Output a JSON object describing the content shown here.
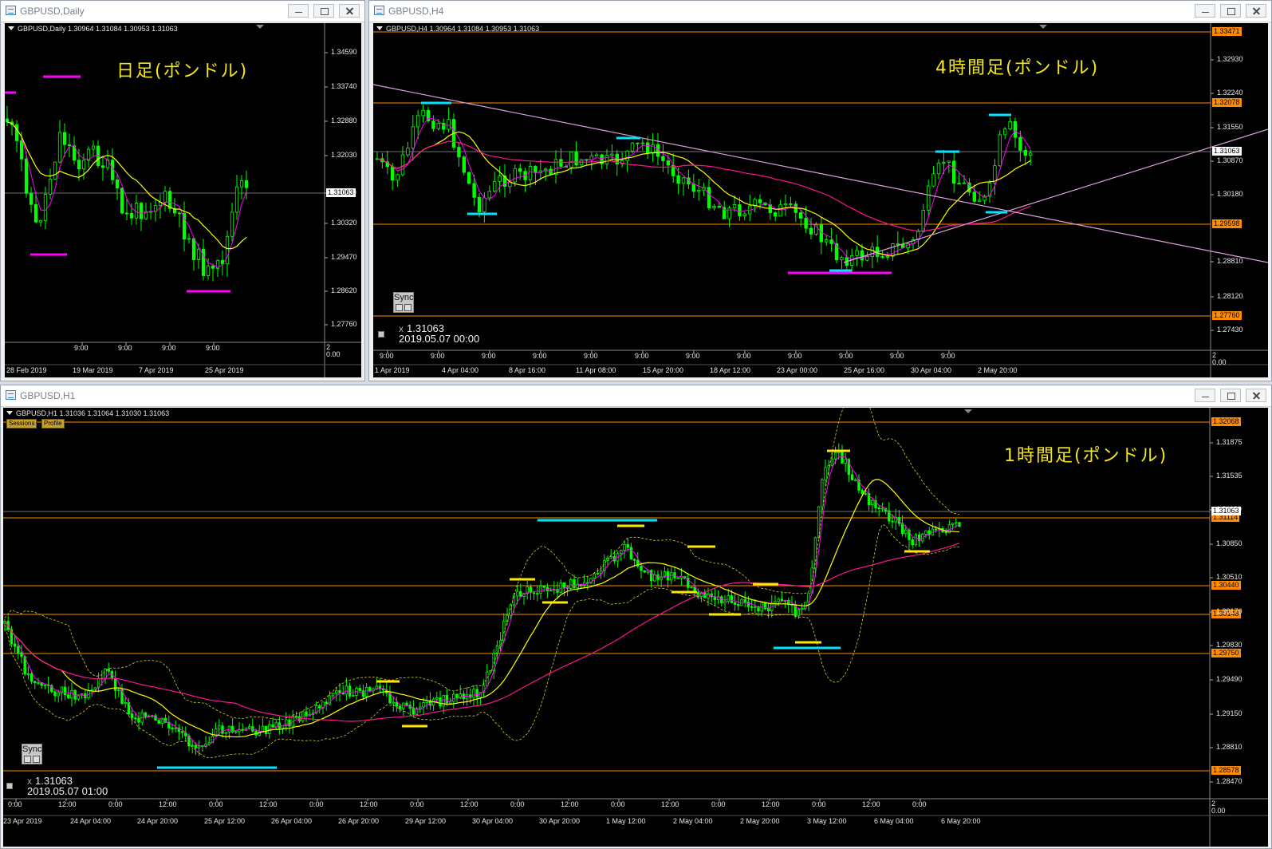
{
  "windows": {
    "daily": {
      "title": "GBPUSD,Daily",
      "header": "GBPUSD,Daily  1.30964 1.31084 1.30953 1.31063",
      "label": "日足(ポンドル)",
      "current_price": "1.31063",
      "price_labels": [
        "1.34590",
        "1.33740",
        "1.32880",
        "1.32030",
        "1.31180",
        "1.30320",
        "1.29470",
        "1.28620",
        "1.27760"
      ],
      "lower_axis_labels": [
        "2",
        "0.00"
      ],
      "time_labels": [
        "9:00",
        "9:00",
        "9:00",
        "9:00"
      ],
      "date_labels": [
        "28 Feb 2019",
        "19 Mar 2019",
        "7 Apr 2019",
        "25 Apr 2019"
      ]
    },
    "h4": {
      "title": "GBPUSD,H4",
      "header": "GBPUSD,H4  1.30964 1.31084 1.30953 1.31063",
      "label": "4時間足(ポンドル)",
      "current_price": "1.31063",
      "price_labels": [
        "1.32930",
        "1.32240",
        "1.31550",
        "1.30870",
        "1.30180",
        "1.28810",
        "1.28120",
        "1.27430"
      ],
      "orange_levels": [
        "1.33471",
        "1.32078",
        "1.29598",
        "1.27760"
      ],
      "lower_axis_labels": [
        "2",
        "0.00"
      ],
      "time_labels": [
        "9:00",
        "9:00",
        "9:00",
        "9:00",
        "9:00",
        "9:00",
        "9:00",
        "9:00",
        "9:00",
        "9:00",
        "9:00",
        "9:00"
      ],
      "date_labels": [
        "1 Apr 2019",
        "4 Apr 04:00",
        "8 Apr 16:00",
        "11 Apr 08:00",
        "15 Apr 20:00",
        "18 Apr 12:00",
        "23 Apr 00:00",
        "25 Apr 16:00",
        "30 Apr 04:00",
        "2 May 20:00"
      ],
      "sync_label": "Sync",
      "cross_x": "X",
      "cross_price": "1.31063",
      "cross_time": "2019.05.07 00:00"
    },
    "h1": {
      "title": "GBPUSD,H1",
      "header": "GBPUSD,H1  1.31036 1.31064 1.31030 1.31063",
      "label": "1時間足(ポンドル)",
      "session_button": "Sessions",
      "profile_button": "Profile",
      "current_price": "1.31063",
      "price_labels": [
        "1.31875",
        "1.31535",
        "1.31190",
        "1.30850",
        "1.30510",
        "1.30170",
        "1.29830",
        "1.29490",
        "1.29150",
        "1.28810",
        "1.28470"
      ],
      "orange_levels": [
        "1.32068",
        "1.31114",
        "1.30440",
        "1.30148",
        "1.29750",
        "1.28578"
      ],
      "lower_axis_labels": [
        "2",
        "0.00"
      ],
      "time_labels": [
        "0:00",
        "12:00",
        "0:00",
        "12:00",
        "0:00",
        "12:00",
        "0:00",
        "12:00",
        "0:00",
        "12:00",
        "0:00",
        "12:00",
        "0:00",
        "12:00",
        "0:00",
        "12:00",
        "0:00",
        "12:00",
        "0:00"
      ],
      "date_labels": [
        "23 Apr 2019",
        "24 Apr 04:00",
        "24 Apr 20:00",
        "25 Apr 12:00",
        "26 Apr 04:00",
        "26 Apr 20:00",
        "29 Apr 12:00",
        "30 Apr 04:00",
        "30 Apr 20:00",
        "1 May 12:00",
        "2 May 04:00",
        "2 May 20:00",
        "3 May 12:00",
        "6 May 04:00",
        "6 May 20:00"
      ],
      "sync_label": "Sync",
      "cross_x": "X",
      "cross_price": "1.31063",
      "cross_time": "2019.05.07 01:00"
    }
  },
  "colors": {
    "candle": "#00ff00",
    "ma_fast": "#ff00ff",
    "ma_mid": "#ffff00",
    "ma_slow": "#ff1493",
    "level_line": "#ff8c00",
    "trend_line": "#dda0dd",
    "marker_cyan": "#00e5ff",
    "marker_yellow": "#ffe600",
    "marker_magenta": "#ff00ff"
  }
}
